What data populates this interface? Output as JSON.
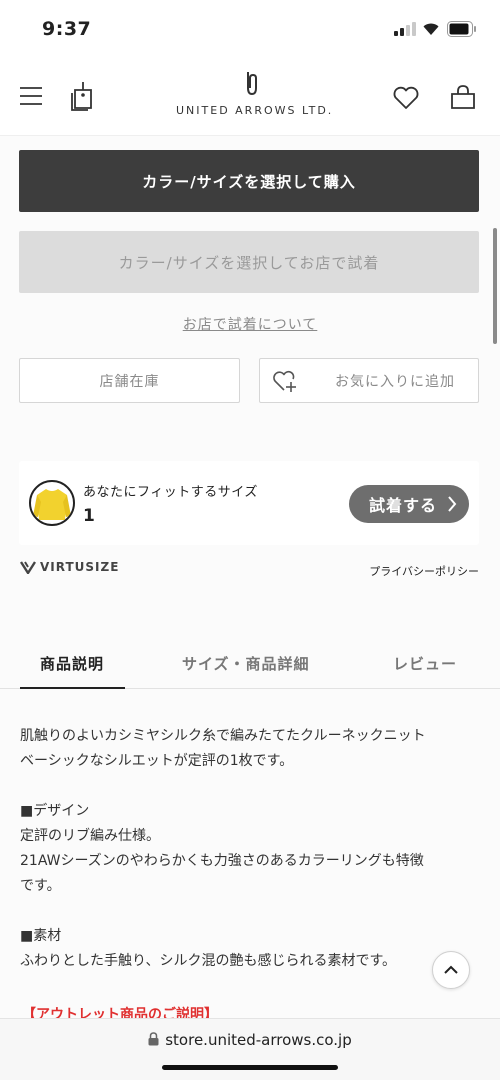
{
  "status_bar": {
    "time": "9:37"
  },
  "header": {
    "brand": "UNITED ARROWS LTD.",
    "icons": [
      "menu-icon",
      "tag-icon",
      "heart-icon",
      "shopping-bag-icon"
    ]
  },
  "actions": {
    "buy_label": "カラー/サイズを選択して購入",
    "try_in_store_label": "カラー/サイズを選択してお店で試着",
    "about_store_try_link": "お店で試着について",
    "store_stock_label": "店舗在庫",
    "add_favorite_label": "お気に入りに追加"
  },
  "fit_card": {
    "title": "あなたにフィットするサイズ",
    "size": "1",
    "try_on_button": "試着する"
  },
  "virtusize": {
    "logo_text": "VIRTUSIZE",
    "privacy_link": "プライバシーポリシー"
  },
  "tabs": [
    {
      "label": "商品説明",
      "active": true
    },
    {
      "label": "サイズ・商品詳細",
      "active": false
    },
    {
      "label": "レビュー",
      "active": false
    }
  ],
  "description": {
    "lines": [
      "肌触りのよいカシミヤシルク糸で編みたてたクルーネックニット",
      "ベーシックなシルエットが定評の1枚です。"
    ],
    "design_heading": "■デザイン",
    "design_lines": [
      "定評のリブ編み仕様。",
      "21AWシーズンのやわらかくも力強さのあるカラーリングも特徴",
      "です。"
    ],
    "material_heading": "■素材",
    "material_lines": [
      "ふわりとした手触り、シルク混の艶も感じられる素材です。"
    ],
    "outlet_heading": "【アウトレット商品のご説明】"
  },
  "url_bar": {
    "url": "store.united-arrows.co.jp"
  },
  "colors": {
    "primary_button": "#3d3d3d",
    "disabled_button": "#dcdcdc",
    "outlet_red": "#e03030",
    "product_yellow": "#f2d22e"
  }
}
